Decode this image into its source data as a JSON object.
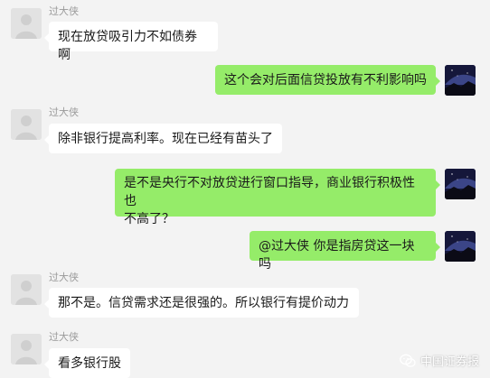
{
  "messages": [
    {
      "sender": "过大侠",
      "text": "现在放贷吸引力不如债券啊"
    },
    {
      "text": "这个会对后面信贷投放有不利影响吗"
    },
    {
      "sender": "过大侠",
      "text": "除非银行提高利率。现在已经有苗头了"
    },
    {
      "line1": "是不是央行不对放贷进行窗口指导，商业银行积极性也",
      "line2": "不高了？"
    },
    {
      "text": "@过大侠 你是指房贷这一块吗"
    },
    {
      "sender": "过大侠",
      "text": "那不是。信贷需求还是很强的。所以银行有提价动力"
    },
    {
      "sender": "过大侠",
      "text": "看多银行股"
    }
  ],
  "watermark": {
    "text": "中国证券报",
    "icon": "wechat-icon"
  },
  "colors": {
    "background": "#f3f3f3",
    "incoming": "#ffffff",
    "outgoing": "#95ec69"
  }
}
